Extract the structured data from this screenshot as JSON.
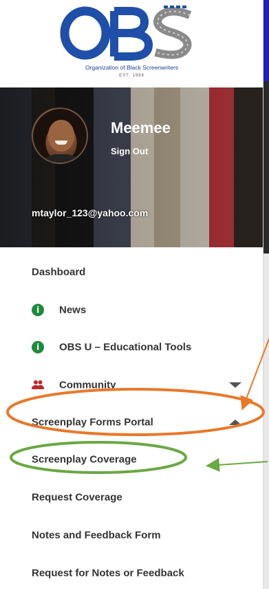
{
  "logo": {
    "letters": "OBS",
    "org_name": "Organization of Black Screenwriters",
    "est": "EST. 1988"
  },
  "profile": {
    "name": "Meemee",
    "sign_out_label": "Sign Out",
    "email": "mtaylor_123@yahoo.com"
  },
  "menu": {
    "items": [
      {
        "label": "Dashboard",
        "icon": "",
        "chevron": ""
      },
      {
        "label": "News",
        "icon": "info-icon",
        "chevron": ""
      },
      {
        "label": "OBS U – Educational Tools",
        "icon": "info-icon",
        "chevron": ""
      },
      {
        "label": "Community",
        "icon": "people-icon",
        "chevron": "down"
      },
      {
        "label": "Screenplay Forms Portal",
        "icon": "",
        "chevron": "up"
      },
      {
        "label": "Screenplay Coverage",
        "icon": "",
        "chevron": ""
      },
      {
        "label": "Request Coverage",
        "icon": "",
        "chevron": ""
      },
      {
        "label": "Notes and Feedback Form",
        "icon": "",
        "chevron": ""
      },
      {
        "label": "Request for Notes or Feedback",
        "icon": "",
        "chevron": ""
      }
    ]
  },
  "colors": {
    "brand_blue": "#1f4fa8",
    "info_green": "#1e8a3c",
    "community_red": "#c0262d",
    "annotation_orange": "#e8782a",
    "annotation_green": "#6aa843"
  }
}
